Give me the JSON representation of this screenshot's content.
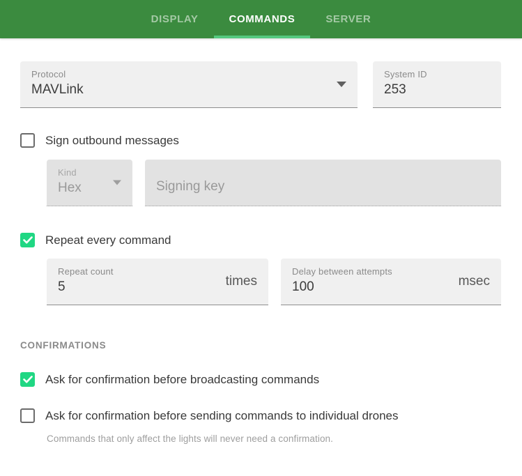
{
  "header": {
    "tabs": [
      {
        "label": "DISPLAY",
        "active": false
      },
      {
        "label": "COMMANDS",
        "active": true
      },
      {
        "label": "SERVER",
        "active": false
      }
    ]
  },
  "form": {
    "protocol": {
      "label": "Protocol",
      "value": "MAVLink"
    },
    "system_id": {
      "label": "System ID",
      "value": "253"
    },
    "sign_outbound": {
      "label": "Sign outbound messages",
      "checked": false
    },
    "signing": {
      "kind": {
        "label": "Kind",
        "value": "Hex"
      },
      "key": {
        "placeholder": "Signing key"
      }
    },
    "repeat": {
      "label": "Repeat every command",
      "checked": true
    },
    "repeat_count": {
      "label": "Repeat count",
      "value": "5",
      "suffix": "times"
    },
    "delay": {
      "label": "Delay between attempts",
      "value": "100",
      "suffix": "msec"
    },
    "confirmations": {
      "section_title": "CONFIRMATIONS",
      "broadcast": {
        "label": "Ask for confirmation before broadcasting commands",
        "checked": true
      },
      "individual": {
        "label": "Ask for confirmation before sending commands to individual drones",
        "checked": false
      },
      "helper": "Commands that only affect the lights will never need a confirmation."
    }
  },
  "colors": {
    "header_green": "#3b8b3f",
    "tab_inactive": "#a4c9a5",
    "tab_indicator": "#55c87f",
    "checkbox_green": "#20d783"
  }
}
